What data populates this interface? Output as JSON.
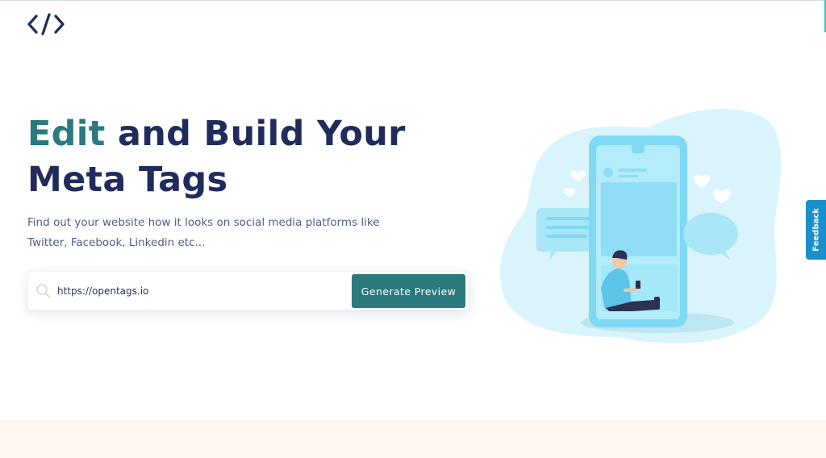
{
  "header": {
    "logo_icon": "code-brackets-icon"
  },
  "hero": {
    "title_accent": "Edit",
    "title_rest": " and Build Your Meta Tags",
    "subtitle": "Find out your website how it looks on social media platforms like Twitter, Facebook, Linkedin etc..."
  },
  "search": {
    "icon": "search-icon",
    "value": "https://opentags.io",
    "button_label": "Generate Preview"
  },
  "feedback": {
    "label": "Feedback"
  },
  "colors": {
    "brand_dark": "#1f2c5c",
    "accent": "#2a7a80",
    "feedback": "#1b8fcc",
    "illustration_light": "#d9f4fc",
    "illustration_mid": "#7fd9f5"
  }
}
